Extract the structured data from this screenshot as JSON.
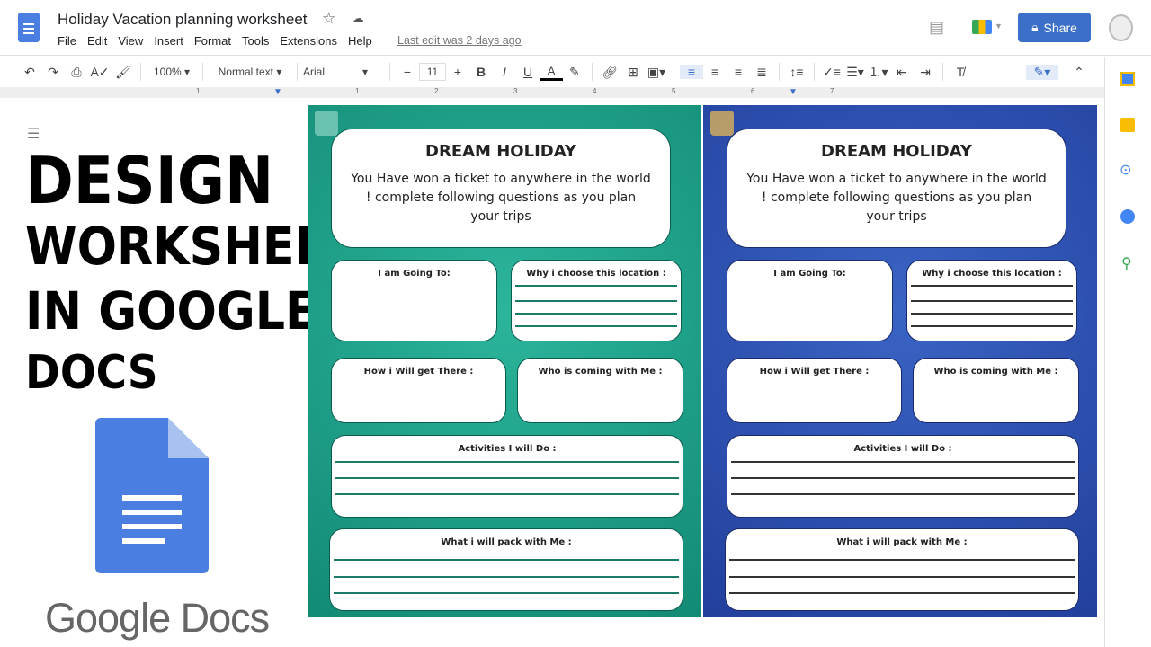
{
  "app": {
    "title": "Holiday Vacation planning worksheet",
    "last_edit": "Last edit was 2 days ago",
    "share_label": "Share",
    "menu": [
      "File",
      "Edit",
      "View",
      "Insert",
      "Format",
      "Tools",
      "Extensions",
      "Help"
    ]
  },
  "toolbar": {
    "zoom": "100%",
    "style": "Normal text",
    "font": "Arial",
    "font_size": "11"
  },
  "ruler": [
    "1",
    "1",
    "2",
    "3",
    "4",
    "5",
    "6",
    "7"
  ],
  "overlay": {
    "lines": [
      "DESIGN",
      "WORKSHEET",
      "IN GOOGLE",
      "DOCS"
    ],
    "logo_text": "Google Docs"
  },
  "worksheet": {
    "title": "DREAM HOLIDAY",
    "intro": "You Have won a ticket to anywhere in the world ! complete following questions as you plan your trips",
    "going": "I am Going To:",
    "why": "Why i choose this location :",
    "how": "How i Will get There :",
    "who": "Who is coming with Me :",
    "activities": "Activities I will Do :",
    "pack": "What i will pack with Me :"
  },
  "colors": {
    "teal_panel": "#1a9c86",
    "blue_panel": "#2a4aa8",
    "share": "#3b6fc8"
  }
}
